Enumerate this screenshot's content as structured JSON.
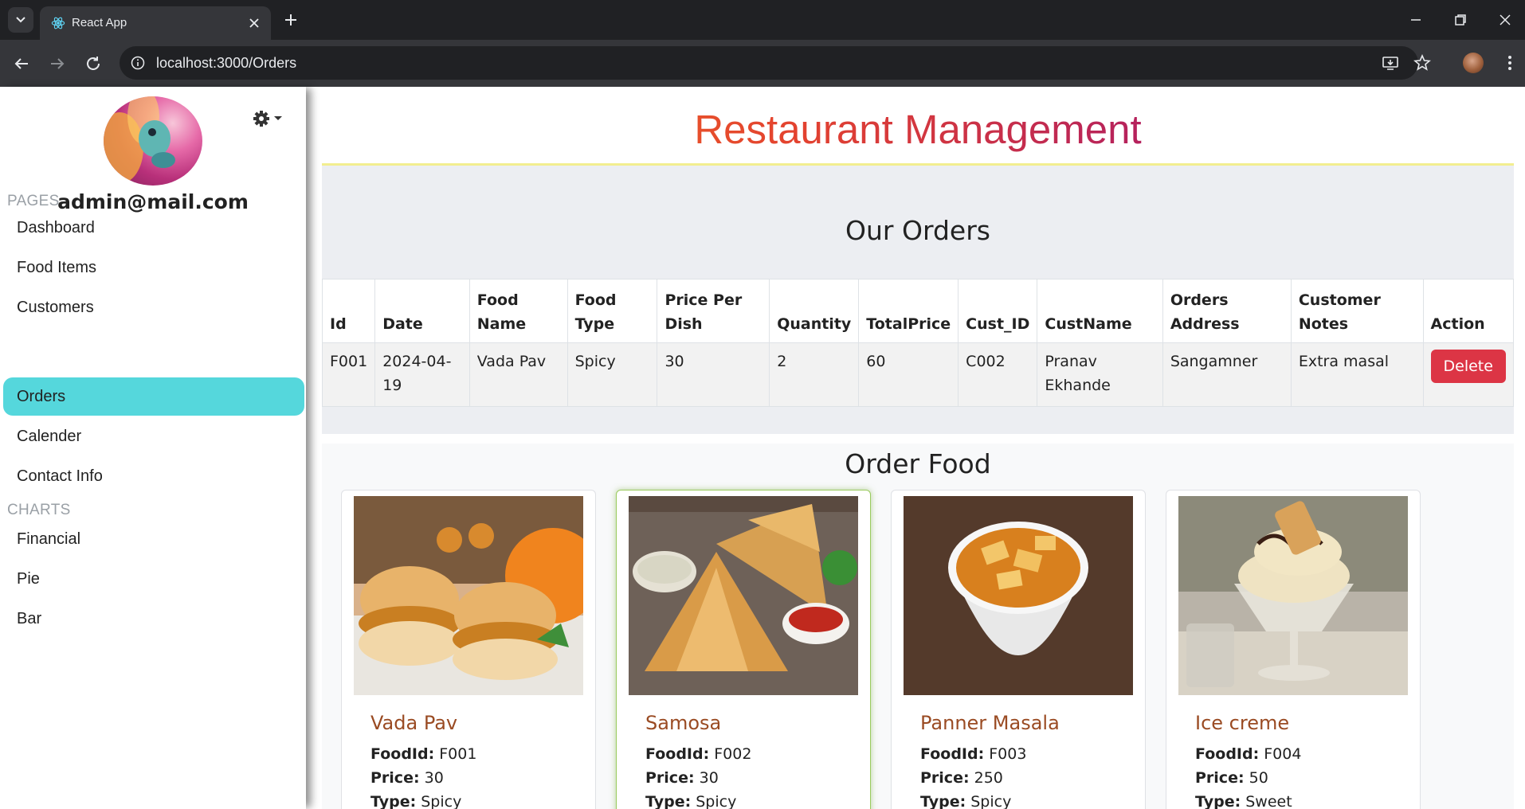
{
  "browser": {
    "tab_title": "React App",
    "url": "localhost:3000/Orders"
  },
  "sidebar": {
    "user_email": "admin@mail.com",
    "sections": [
      {
        "label": "PAGES",
        "items": [
          "Dashboard",
          "Food Items",
          "Customers",
          "Orders",
          "Calender",
          "Contact Info"
        ]
      },
      {
        "label": "CHARTS",
        "items": [
          "Financial",
          "Pie",
          "Bar"
        ]
      }
    ],
    "active_item": "Orders"
  },
  "header": {
    "title": "Restaurant Management"
  },
  "orders": {
    "heading": "Our Orders",
    "columns": [
      "Id",
      "Date",
      "Food Name",
      "Food Type",
      "Price Per Dish",
      "Quantity",
      "TotalPrice",
      "Cust_ID",
      "CustName",
      "Orders Address",
      "Customer Notes",
      "Action"
    ],
    "rows": [
      {
        "id": "F001",
        "date": "2024-04-19",
        "food_name": "Vada Pav",
        "food_type": "Spicy",
        "price_per_dish": "30",
        "quantity": "2",
        "total_price": "60",
        "cust_id": "C002",
        "cust_name": "Pranav Ekhande",
        "address": "Sangamner",
        "notes": "Extra masal",
        "action_label": "Delete"
      }
    ]
  },
  "order_food": {
    "heading": "Order Food",
    "labels": {
      "food_id": "FoodId:",
      "price": "Price:",
      "type": "Type:"
    },
    "items": [
      {
        "name": "Vada Pav",
        "food_id": "F001",
        "price": "30",
        "type": "Spicy"
      },
      {
        "name": "Samosa",
        "food_id": "F002",
        "price": "30",
        "type": "Spicy"
      },
      {
        "name": "Panner Masala",
        "food_id": "F003",
        "price": "250",
        "type": "Spicy"
      },
      {
        "name": "Ice creme",
        "food_id": "F004",
        "price": "50",
        "type": "Sweet"
      }
    ]
  },
  "colors": {
    "active_nav": "#55d7dc",
    "delete_button": "#dc3545",
    "card_title": "#9a4b23",
    "title_gradient_start": "#f57c20",
    "title_gradient_end": "#8c1b8a"
  }
}
